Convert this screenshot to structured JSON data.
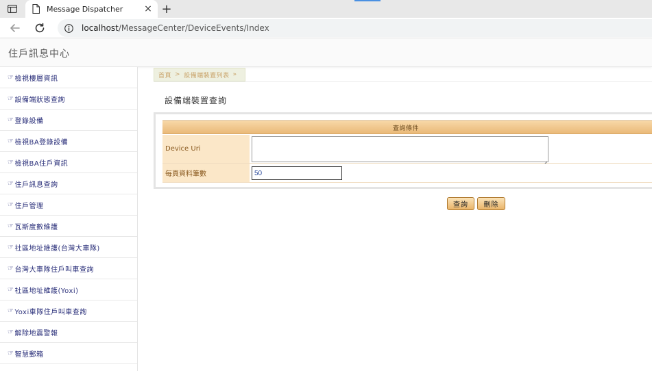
{
  "browser": {
    "tab_title": "Message Dispatcher",
    "tab_close": "×",
    "new_tab": "+",
    "url_host": "localhost",
    "url_path": "/MessageCenter/DeviceEvents/Index"
  },
  "app": {
    "title": "住戶訊息中心"
  },
  "sidebar": {
    "hand_glyph": "☞",
    "items": [
      {
        "label": "檢視樓層資訊"
      },
      {
        "label": "設備端狀態查詢"
      },
      {
        "label": "登錄設備"
      },
      {
        "label": "檢視BA登錄設備"
      },
      {
        "label": "檢視BA住戶資訊"
      },
      {
        "label": "住戶訊息查詢"
      },
      {
        "label": "住戶管理"
      },
      {
        "label": "瓦斯度數維護"
      },
      {
        "label": "社區地址維護(台灣大車隊)"
      },
      {
        "label": "台灣大車隊住戶叫車查詢"
      },
      {
        "label": "社區地址維護(Yoxi)"
      },
      {
        "label": "Yoxi車隊住戶叫車查詢"
      },
      {
        "label": "解除地震警報"
      },
      {
        "label": "智慧郵箱"
      }
    ]
  },
  "breadcrumb": {
    "home": "首頁",
    "separator": ">",
    "current": "設備端裝置列表",
    "trailing": "»"
  },
  "main": {
    "page_title": "設備端裝置查詢",
    "form": {
      "header": "查詢條件",
      "device_uri_label": "Device Uri",
      "device_uri_value": "",
      "per_page_label": "每頁資料筆數",
      "per_page_value": "50"
    },
    "buttons": {
      "query": "查詢",
      "delete": "刪除"
    }
  },
  "colors": {
    "accent": "#4a90e2",
    "sidebar_text": "#2a2f7a",
    "form_header": "#eab978",
    "form_label_bg": "#fbe7c8"
  }
}
